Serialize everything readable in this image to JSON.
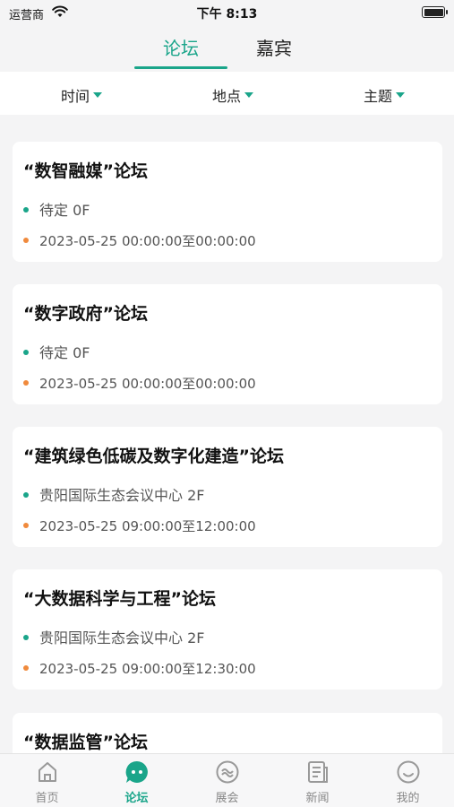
{
  "status_bar": {
    "carrier": "运营商",
    "time": "下午 8:13"
  },
  "top_tabs": [
    {
      "label": "论坛",
      "active": true
    },
    {
      "label": "嘉宾",
      "active": false
    }
  ],
  "filters": [
    {
      "label": "时间"
    },
    {
      "label": "地点"
    },
    {
      "label": "主题"
    }
  ],
  "forums": [
    {
      "title": "“数智融媒”论坛",
      "location": "待定 0F",
      "time": "2023-05-25 00:00:00至00:00:00"
    },
    {
      "title": "“数字政府”论坛",
      "location": "待定 0F",
      "time": "2023-05-25 00:00:00至00:00:00"
    },
    {
      "title": "“建筑绿色低碳及数字化建造”论坛",
      "location": "贵阳国际生态会议中心 2F",
      "time": "2023-05-25 09:00:00至12:00:00"
    },
    {
      "title": "“大数据科学与工程”论坛",
      "location": "贵阳国际生态会议中心 2F",
      "time": "2023-05-25 09:00:00至12:30:00"
    },
    {
      "title": "“数据监管”论坛",
      "location": "",
      "time": ""
    }
  ],
  "tabbar": [
    {
      "label": "首页",
      "icon": "home-icon"
    },
    {
      "label": "论坛",
      "icon": "chat-bubble-icon",
      "active": true
    },
    {
      "label": "展会",
      "icon": "exhibition-icon"
    },
    {
      "label": "新闻",
      "icon": "news-icon"
    },
    {
      "label": "我的",
      "icon": "smiley-icon"
    }
  ],
  "colors": {
    "accent": "#1aa58a",
    "dot_orange": "#f08a3c"
  }
}
